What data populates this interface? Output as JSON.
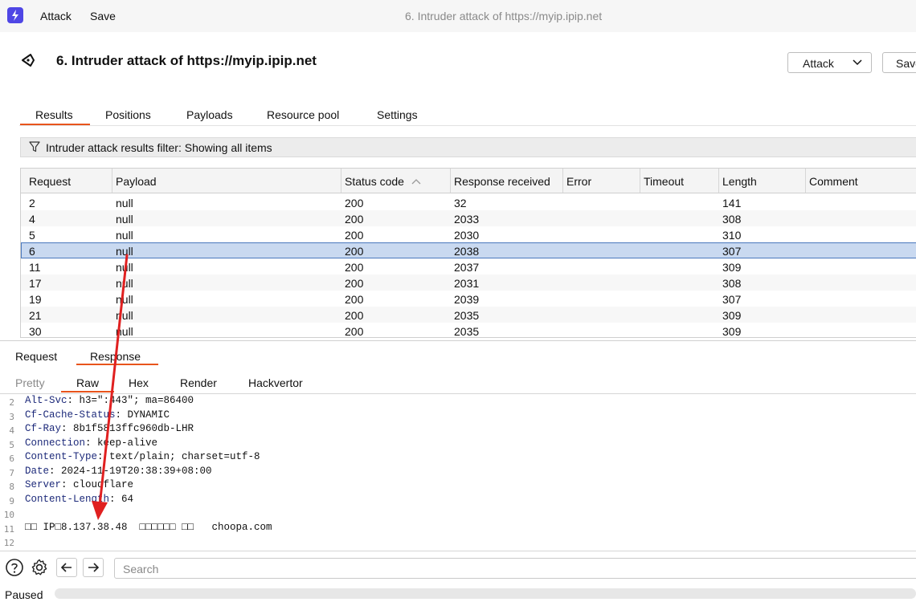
{
  "window": {
    "menu": [
      "Attack",
      "Save"
    ],
    "title": "6. Intruder attack of https://myip.ipip.net"
  },
  "header": {
    "title": "6. Intruder attack of https://myip.ipip.net",
    "attack_button": "Attack",
    "save_button": "Save"
  },
  "tabs": [
    "Results",
    "Positions",
    "Payloads",
    "Resource pool",
    "Settings"
  ],
  "active_tab": "Results",
  "filter": {
    "text": "Intruder attack results filter: Showing all items"
  },
  "table": {
    "columns": [
      "Request",
      "Payload",
      "Status code",
      "Response received",
      "Error",
      "Timeout",
      "Length",
      "Comment"
    ],
    "sort_column": "Status code",
    "rows": [
      [
        "2",
        "null",
        "200",
        "32",
        "",
        "",
        "141",
        ""
      ],
      [
        "4",
        "null",
        "200",
        "2033",
        "",
        "",
        "308",
        ""
      ],
      [
        "5",
        "null",
        "200",
        "2030",
        "",
        "",
        "310",
        ""
      ],
      [
        "6",
        "null",
        "200",
        "2038",
        "",
        "",
        "307",
        ""
      ],
      [
        "11",
        "null",
        "200",
        "2037",
        "",
        "",
        "309",
        ""
      ],
      [
        "17",
        "null",
        "200",
        "2031",
        "",
        "",
        "308",
        ""
      ],
      [
        "19",
        "null",
        "200",
        "2039",
        "",
        "",
        "307",
        ""
      ],
      [
        "21",
        "null",
        "200",
        "2035",
        "",
        "",
        "309",
        ""
      ],
      [
        "30",
        "null",
        "200",
        "2035",
        "",
        "",
        "309",
        ""
      ]
    ],
    "selected_request": "6"
  },
  "pane_tabs": [
    "Request",
    "Response"
  ],
  "active_pane_tab": "Response",
  "view_tabs": [
    "Pretty",
    "Raw",
    "Hex",
    "Render",
    "Hackvertor"
  ],
  "active_view_tab": "Raw",
  "raw_lines": [
    {
      "n": "2",
      "key": "Alt-Svc",
      "val": " h3=\":443\"; ma=86400"
    },
    {
      "n": "3",
      "key": "Cf-Cache-Status",
      "val": " DYNAMIC"
    },
    {
      "n": "4",
      "key": "Cf-Ray",
      "val": " 8b1f5813ffc960db-LHR"
    },
    {
      "n": "5",
      "key": "Connection",
      "val": " keep-alive"
    },
    {
      "n": "6",
      "key": "Content-Type",
      "val": " text/plain; charset=utf-8"
    },
    {
      "n": "7",
      "key": "Date",
      "val": " 2024-11-19T20:38:39+08:00"
    },
    {
      "n": "8",
      "key": "Server",
      "val": " cloudflare"
    },
    {
      "n": "9",
      "key": "Content-Length",
      "val": " 64"
    },
    {
      "n": "10",
      "key": "",
      "val": ""
    },
    {
      "n": "11",
      "key": "",
      "val": "□□ IP□8.137.38.48  □□□□□□ □□   choopa.com"
    },
    {
      "n": "12",
      "key": "",
      "val": ""
    }
  ],
  "search": {
    "placeholder": "Search",
    "value": ""
  },
  "status": {
    "text": "Paused"
  },
  "colors": {
    "accent": "#e8541c",
    "selection": "#c9d9f0",
    "annotation_arrow": "#e02020"
  }
}
